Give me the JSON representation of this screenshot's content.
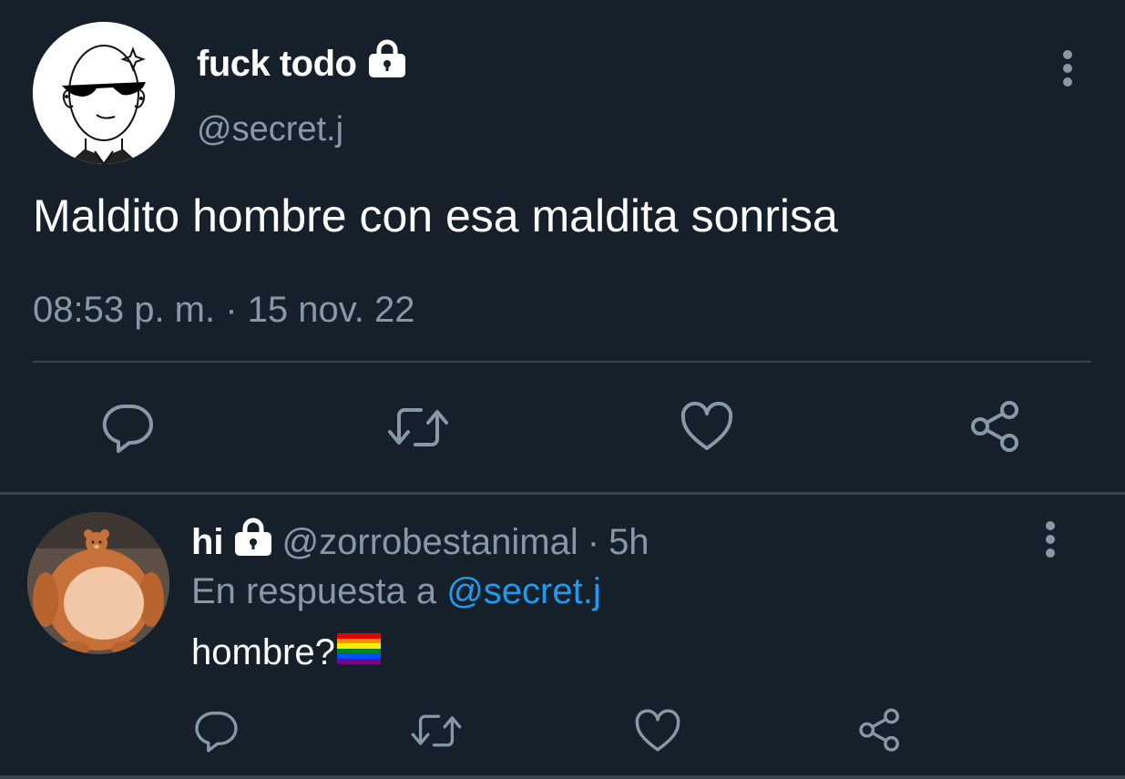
{
  "tweet": {
    "display_name": "fuck todo",
    "handle": "@secret.j",
    "text": "Maldito hombre con esa maldita sonrisa",
    "timestamp": "08:53 p. m. · 15 nov. 22",
    "protected": true
  },
  "reply": {
    "display_name": "hi",
    "handle": "@zorrobestanimal",
    "separator": "·",
    "age": "5h",
    "replying_to_prefix": "En respuesta a",
    "replying_to_handle": "@secret.j",
    "text": "hombre?",
    "protected": true
  },
  "icons": {
    "lock": "lock-icon",
    "more": "more-vertical-icon",
    "reply": "reply-icon",
    "retweet": "retweet-icon",
    "like": "heart-icon",
    "share": "share-icon",
    "flag": "rainbow-flag-emoji"
  },
  "colors": {
    "background": "#15202b",
    "secondary_text": "#8899a6",
    "divider": "#38444d",
    "link": "#1d9bf0",
    "icon": "#8899a6"
  }
}
